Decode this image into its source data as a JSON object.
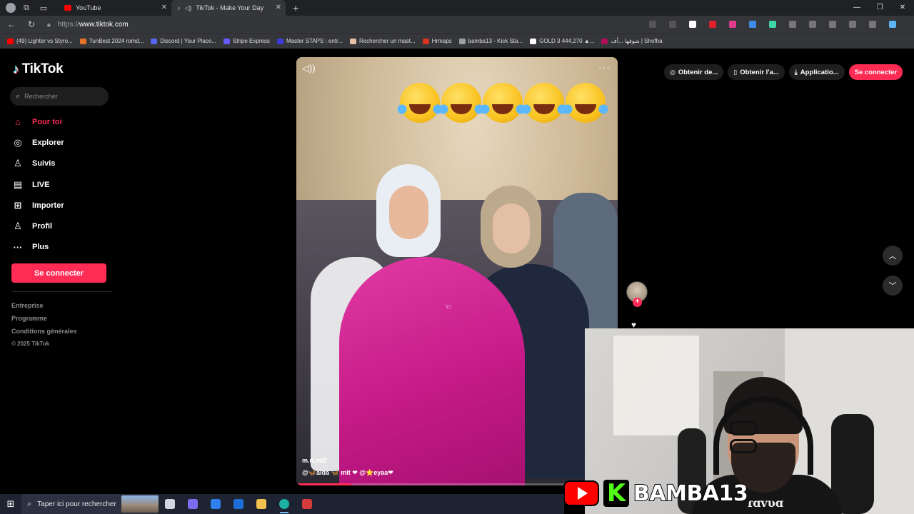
{
  "browser": {
    "tabs": [
      {
        "label": "YouTube",
        "icon": "youtube-icon",
        "active": false
      },
      {
        "label": "TikTok - Make Your Day",
        "icon": "tiktok-icon",
        "active": true
      }
    ],
    "url_prefix": "https://",
    "url_domain": "www.tiktok.com",
    "bookmarks": [
      {
        "label": "(49) Lighter vs Styro...",
        "color": "#ff0000"
      },
      {
        "label": "TunBest 2024 romd...",
        "color": "#e8742a"
      },
      {
        "label": "Discord | Your Place...",
        "color": "#5865f2"
      },
      {
        "label": "Stripe Express",
        "color": "#635bff"
      },
      {
        "label": "Master STAPS : entr...",
        "color": "#3b3bd9"
      },
      {
        "label": "Rechercher un mast...",
        "color": "#e8c1a6"
      },
      {
        "label": "Hrmaps",
        "color": "#d9331f"
      },
      {
        "label": "bamba13 - Kick Sta...",
        "color": "#9aa0a6"
      },
      {
        "label": "GOLD 3 444,270 ▲...",
        "color": "#ffffff"
      },
      {
        "label": "شوفها | Shofha",
        "color": "#b0105a",
        "prefix": "أف..."
      }
    ]
  },
  "tiktok": {
    "brand": "TikTok",
    "search_placeholder": "Rechercher",
    "nav": [
      {
        "label": "Pour toi",
        "icon": "home-icon",
        "glyph": "⌂",
        "active": true
      },
      {
        "label": "Explorer",
        "icon": "compass-icon",
        "glyph": "◎",
        "active": false
      },
      {
        "label": "Suivis",
        "icon": "following-icon",
        "glyph": "♙",
        "active": false
      },
      {
        "label": "LIVE",
        "icon": "live-icon",
        "glyph": "▤",
        "active": false
      },
      {
        "label": "Importer",
        "icon": "upload-icon",
        "glyph": "⊞",
        "active": false
      },
      {
        "label": "Profil",
        "icon": "profile-icon",
        "glyph": "♙",
        "active": false
      },
      {
        "label": "Plus",
        "icon": "more-icon",
        "glyph": "···",
        "active": false
      }
    ],
    "login_label": "Se connecter",
    "footer": [
      "Entreprise",
      "Programme",
      "Conditions générales"
    ],
    "copyright": "© 2025 TikTok",
    "top_actions": [
      {
        "label": "Obtenir de...",
        "icon": "coin-icon",
        "glyph": "◎"
      },
      {
        "label": "Obtenir l'a...",
        "icon": "phone-icon",
        "glyph": "▯"
      },
      {
        "label": "Applicatio...",
        "icon": "download-icon",
        "glyph": "⤓"
      }
    ],
    "top_login_label": "Se connecter",
    "video": {
      "author": "m.n.mt2",
      "caption": "@🦋aida 🦋 mlt ❤ @⭐eyaa❤",
      "progress": 0.17
    }
  },
  "stream": {
    "channel_name": "BAMBA13",
    "brand_text": "ɾɑvυɑ"
  },
  "taskbar": {
    "search_placeholder": "Taper ici pour rechercher",
    "apps": [
      {
        "icon": "task-view-icon",
        "color": "#cfd6e0"
      },
      {
        "icon": "copilot-icon",
        "color": "#7a6cf0"
      },
      {
        "icon": "store-icon",
        "color": "#2f80ed"
      },
      {
        "icon": "mail-icon",
        "color": "#1d6fd8"
      },
      {
        "icon": "file-explorer-icon",
        "color": "#f2c14e"
      },
      {
        "icon": "edge-icon",
        "color": "#1bb3a4",
        "active": true
      },
      {
        "icon": "screen-tool-icon",
        "color": "#d83b3b"
      }
    ]
  }
}
